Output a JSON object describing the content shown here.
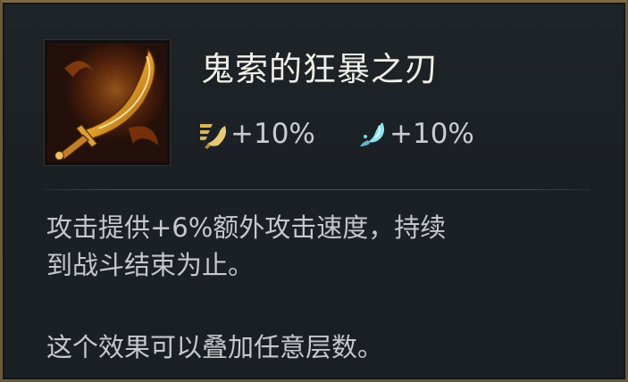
{
  "item": {
    "name": "鬼索的狂暴之刃",
    "icon": "guinsoo-rageblade-icon"
  },
  "stats": [
    {
      "icon": "attack-damage-icon",
      "value": "+10%",
      "color": "#d9b45a"
    },
    {
      "icon": "ability-power-icon",
      "value": "+10%",
      "color": "#7fd8e6"
    }
  ],
  "description": {
    "line1": "攻击提供+6%额外攻击速度，持续",
    "line2": "到战斗结束为止。",
    "line3": "这个效果可以叠加任意层数。"
  },
  "colors": {
    "border": "#6a5a3a",
    "background": "#1c2126",
    "title": "#f1efe8",
    "body_text": "#c6c8cb"
  }
}
